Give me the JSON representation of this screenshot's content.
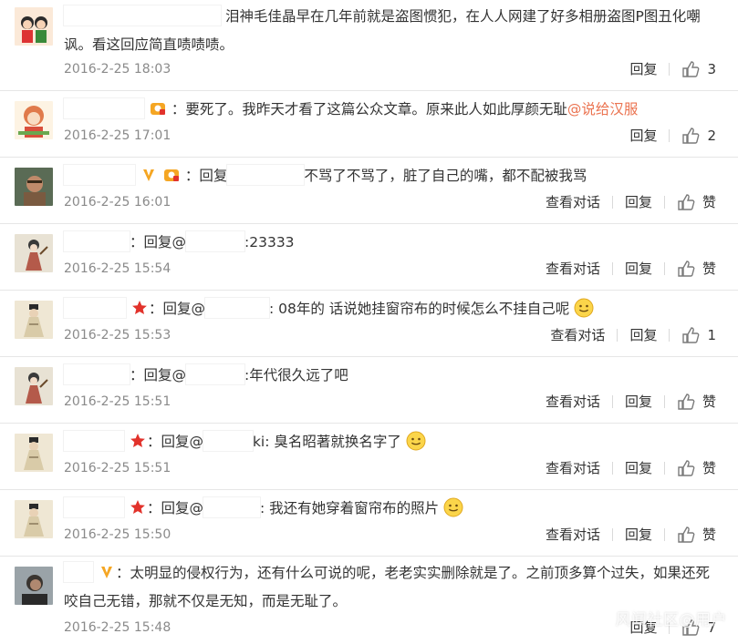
{
  "comments": [
    {
      "text": "泪神毛佳晶早在几年前就是盗图惯犯，在人人网建了好多相册盗图P图丑化嘲讽。看这回应简直啧啧啧。",
      "time": "2016-2-25 18:03",
      "reply_label": "回复",
      "like_count": "3"
    },
    {
      "sep": "：",
      "text": "要死了。我昨天才看了这篇公众文章。原来此人如此厚颜无耻",
      "mention": "@说给汉服",
      "time": "2016-2-25 17:01",
      "reply_label": "回复",
      "like_count": "2"
    },
    {
      "reply_prefix": "：回复",
      "text": "不骂了不骂了，脏了自己的嘴，都不配被我骂",
      "time": "2016-2-25 16:01",
      "view_label": "查看对话",
      "reply_label": "回复",
      "like_label": "赞"
    },
    {
      "reply_prefix": "：回复@",
      "text": ":23333",
      "time": "2016-2-25 15:54",
      "view_label": "查看对话",
      "reply_label": "回复",
      "like_label": "赞"
    },
    {
      "reply_prefix": "：回复@",
      "text": ": 08年的  话说她挂窗帘布的时候怎么不挂自己呢",
      "time": "2016-2-25 15:53",
      "view_label": "查看对话",
      "reply_label": "回复",
      "like_count": "1"
    },
    {
      "reply_prefix": "：回复@",
      "text": ":年代很久远了吧",
      "time": "2016-2-25 15:51",
      "view_label": "查看对话",
      "reply_label": "回复",
      "like_label": "赞"
    },
    {
      "reply_prefix": "：回复@",
      "text": "ki: 臭名昭著就换名字了",
      "time": "2016-2-25 15:51",
      "view_label": "查看对话",
      "reply_label": "回复",
      "like_label": "赞"
    },
    {
      "reply_prefix": "：回复@",
      "text": ": 我还有她穿着窗帘布的照片",
      "time": "2016-2-25 15:50",
      "view_label": "查看对话",
      "reply_label": "回复",
      "like_label": "赞"
    },
    {
      "text": "：太明显的侵权行为，还有什么可说的呢，老老实实删除就是了。之前顶多算个过失，如果还死咬自己无错，那就不仅是无知，而是无耻了。",
      "time": "2016-2-25 15:48",
      "reply_label": "回复",
      "like_count": "7"
    }
  ],
  "watermark": "风闻社区@用户"
}
